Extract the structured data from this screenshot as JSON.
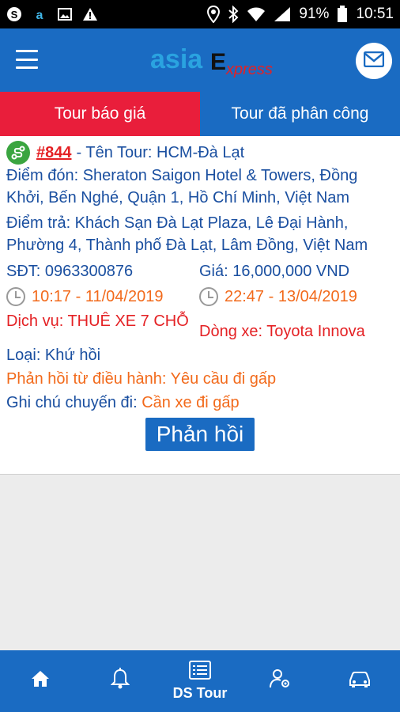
{
  "status_bar": {
    "battery": "91%",
    "time": "10:51"
  },
  "header": {
    "logo_text": "asiaExpress"
  },
  "tabs": [
    {
      "label": "Tour báo giá"
    },
    {
      "label": "Tour đã phân công"
    }
  ],
  "tour": {
    "id": "#844",
    "name_line": "- Tên Tour: HCM-Đà Lạt",
    "pickup": "Điểm đón: Sheraton Saigon Hotel & Towers, Đồng Khởi, Bến Nghé, Quận 1, Hồ Chí Minh, Việt Nam",
    "dropoff": "Điểm trả: Khách Sạn Đà Lạt Plaza, Lê Đại Hành, Phường 4, Thành phố Đà Lạt, Lâm Đồng, Việt Nam",
    "phone": "SĐT: 0963300876",
    "price": "Giá: 16,000,000 VND",
    "start_time": "10:17 - 11/04/2019",
    "end_time": "22:47 - 13/04/2019",
    "service": "Dịch vụ: THUÊ XE 7 CHỖ",
    "vehicle": "Dòng xe: Toyota Innova",
    "type": "Loại: Khứ hồi",
    "feedback_label": "Phản hồi từ điều hành:",
    "feedback_value": "Yêu cầu đi gấp",
    "note_label": "Ghi chú chuyến đi:",
    "note_value": "Cần xe đi gấp",
    "reply_button": "Phản hồi"
  },
  "bottom_nav": [
    {
      "icon": "home-icon",
      "label": ""
    },
    {
      "icon": "bell-icon",
      "label": ""
    },
    {
      "icon": "list-icon",
      "label": "DS Tour"
    },
    {
      "icon": "user-settings-icon",
      "label": ""
    },
    {
      "icon": "car-icon",
      "label": ""
    }
  ],
  "colors": {
    "primary_blue": "#1a6bc2",
    "active_tab_red": "#e91e3b",
    "text_blue": "#1a4fa0",
    "accent_red": "#e42124",
    "accent_orange": "#f26a1b",
    "route_green": "#3aa540"
  }
}
